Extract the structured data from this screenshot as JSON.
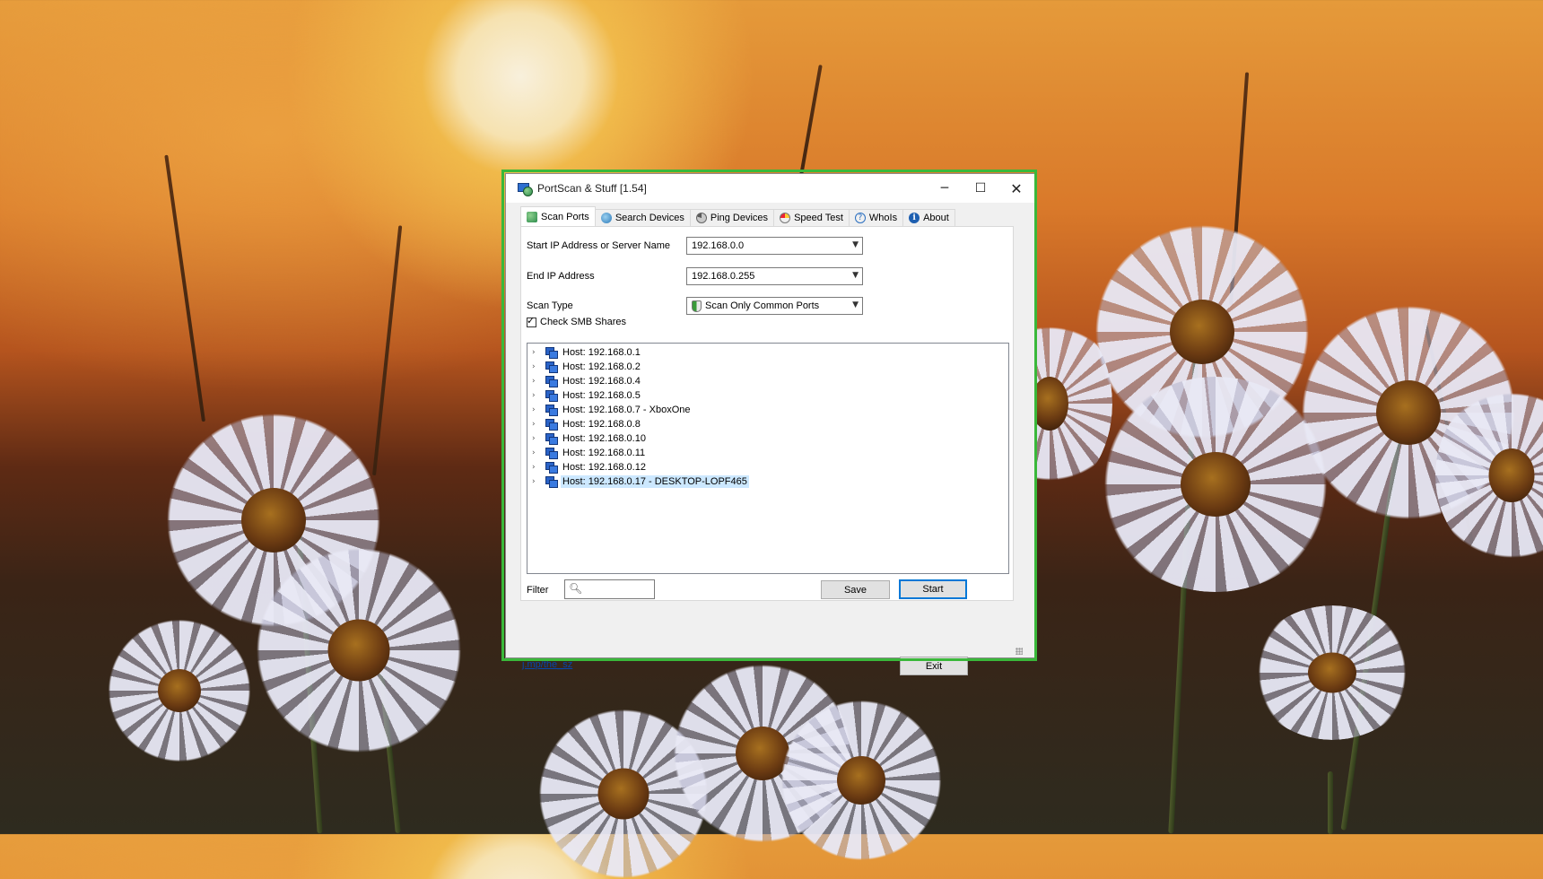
{
  "window": {
    "title": "PortScan & Stuff [1.54]",
    "controls": {
      "minimize": "─",
      "maximize": "☐",
      "close": "✕"
    }
  },
  "tabs": [
    {
      "label": "Scan Ports",
      "icon": "scan-ports-icon",
      "active": true
    },
    {
      "label": "Search Devices",
      "icon": "search-devices-icon"
    },
    {
      "label": "Ping Devices",
      "icon": "ping-icon"
    },
    {
      "label": "Speed Test",
      "icon": "speedometer-icon"
    },
    {
      "label": "WhoIs",
      "icon": "question-icon"
    },
    {
      "label": "About",
      "icon": "info-icon"
    }
  ],
  "form": {
    "start_ip_label": "Start IP Address or Server Name",
    "start_ip_value": "192.168.0.0",
    "end_ip_label": "End IP Address",
    "end_ip_value": "192.168.0.255",
    "scan_type_label": "Scan Type",
    "scan_type_value": "Scan Only Common Ports",
    "smb_label": "Check SMB Shares",
    "smb_checked": true
  },
  "hosts": [
    "Host: 192.168.0.1",
    "Host: 192.168.0.2",
    "Host: 192.168.0.4",
    "Host: 192.168.0.5",
    "Host: 192.168.0.7 - XboxOne",
    "Host: 192.168.0.8",
    "Host: 192.168.0.10",
    "Host: 192.168.0.11",
    "Host: 192.168.0.12",
    "Host: 192.168.0.17 - DESKTOP-LOPF465"
  ],
  "selected_host": "Host: 192.168.0.17 - DESKTOP-LOPF465",
  "filter": {
    "label": "Filter",
    "value": ""
  },
  "buttons": {
    "save": "Save",
    "start": "Start",
    "exit": "Exit"
  },
  "footer_link": "j.mp/the_sz",
  "colors": {
    "focus_frame": "#3ab83a",
    "selection": "#cce8ff",
    "default_button_border": "#0078d7"
  }
}
